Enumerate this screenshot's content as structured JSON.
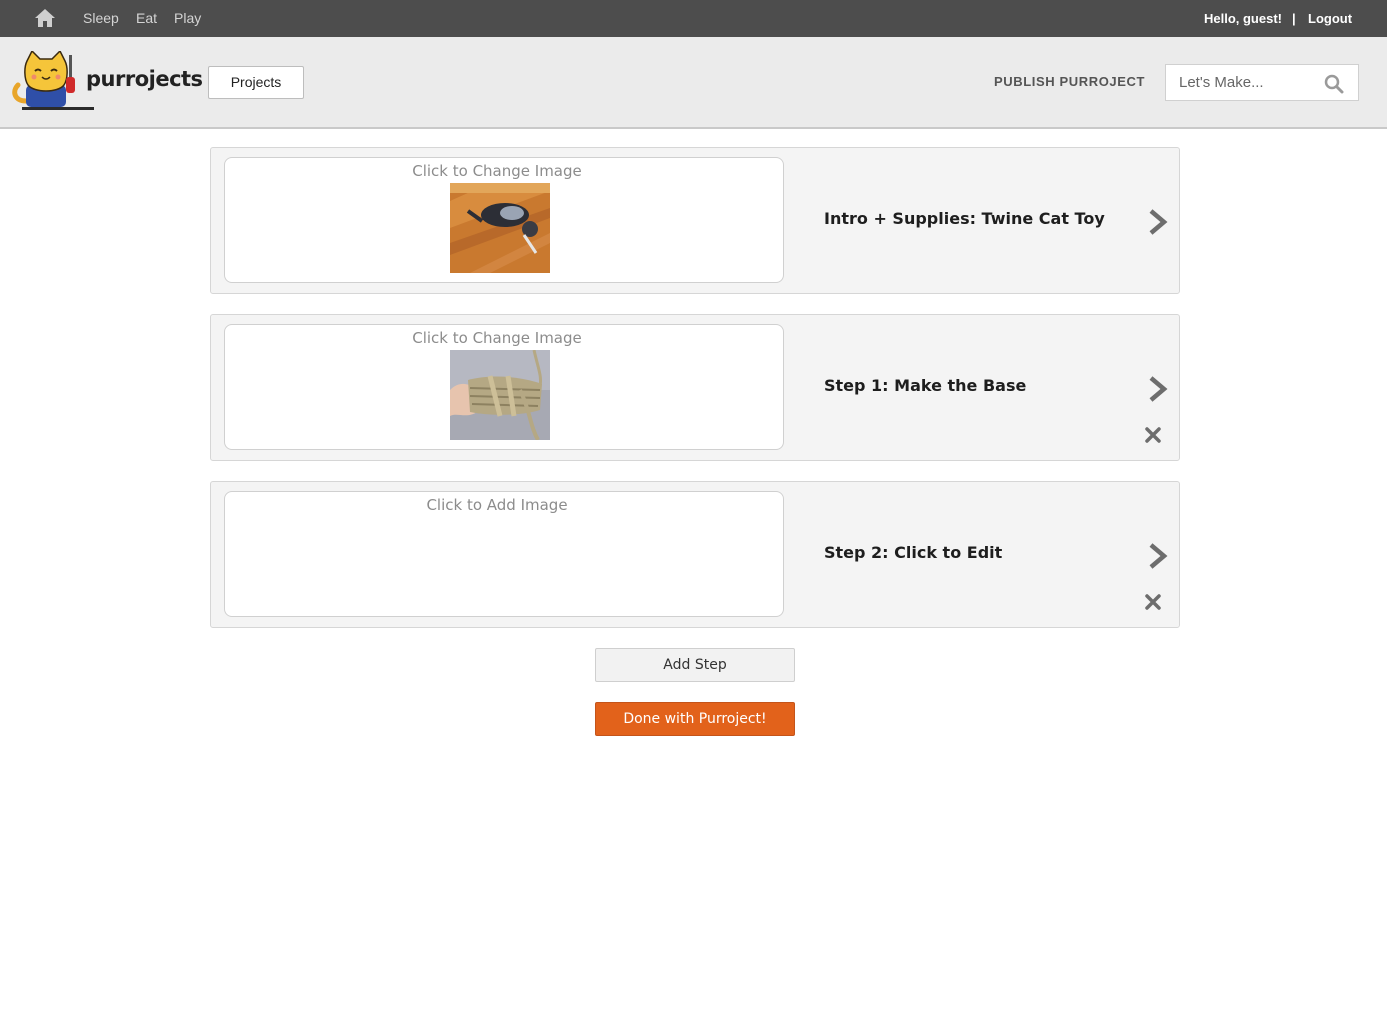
{
  "topnav": {
    "home_icon": "home-icon",
    "links": [
      "Sleep",
      "Eat",
      "Play"
    ],
    "greeting": "Hello, guest!",
    "separator": "|",
    "logout": "Logout"
  },
  "header": {
    "brand": "purrojects",
    "projects_button": "Projects",
    "publish": "PUBLISH PURROJECT",
    "search_placeholder": "Let's Make...",
    "search_icon": "search-icon"
  },
  "steps": [
    {
      "image_caption": "Click to Change Image",
      "title": "Intro + Supplies: Twine Cat Toy",
      "has_image": true,
      "deletable": false
    },
    {
      "image_caption": "Click to Change Image",
      "title": "Step 1: Make the Base",
      "has_image": true,
      "deletable": true
    },
    {
      "image_caption": "Click to Add Image",
      "title": "Step 2: Click to Edit",
      "has_image": false,
      "deletable": true
    }
  ],
  "actions": {
    "add_step": "Add Step",
    "done": "Done with Purroject!"
  },
  "colors": {
    "topbar": "#4d4d4d",
    "header": "#ebebeb",
    "accent": "#e2621b",
    "card": "#f4f4f4"
  }
}
